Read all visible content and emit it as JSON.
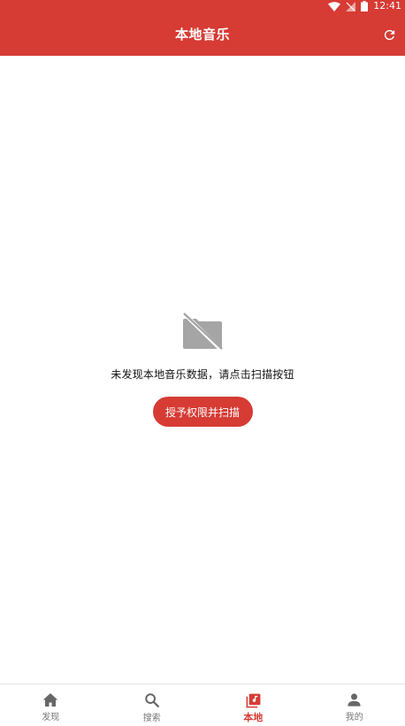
{
  "status_bar": {
    "time": "12:41",
    "icons": [
      "wifi-icon",
      "signal-icon",
      "battery-icon"
    ]
  },
  "header": {
    "title": "本地音乐",
    "refresh_icon": "refresh-icon"
  },
  "empty_state": {
    "icon": "no-folder-icon",
    "message": "未发现本地音乐数据，请点击扫描按钮",
    "button_label": "授予权限并扫描"
  },
  "bottom_nav": {
    "items": [
      {
        "label": "发现",
        "icon": "home-icon",
        "active": false
      },
      {
        "label": "搜索",
        "icon": "search-icon",
        "active": false
      },
      {
        "label": "本地",
        "icon": "library-music-icon",
        "active": true
      },
      {
        "label": "我的",
        "icon": "person-icon",
        "active": false
      }
    ]
  },
  "colors": {
    "primary": "#d63b34",
    "inactive": "#666666",
    "empty_icon": "#a5a5a5"
  }
}
